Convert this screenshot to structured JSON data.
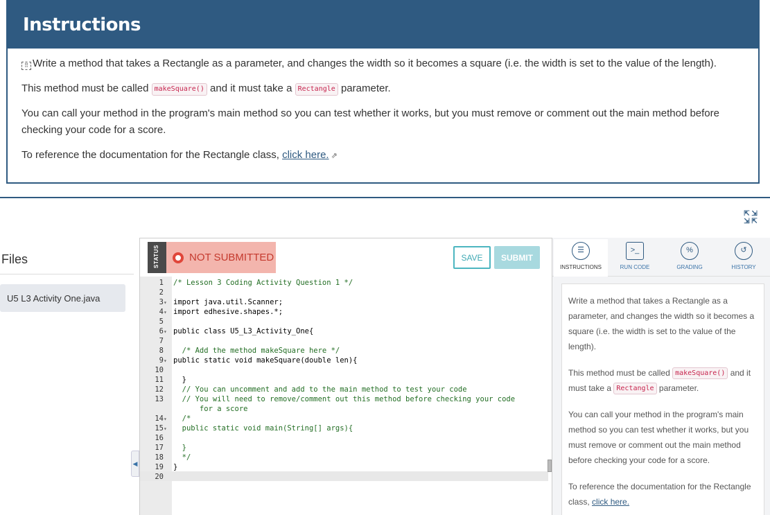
{
  "instructions": {
    "title": "Instructions",
    "p1": "Write a method that takes a Rectangle as a parameter, and changes the width so it becomes a square (i.e. the width is set to the value of the length).",
    "p2_before": "This method must be called",
    "p2_code1": "makeSquare()",
    "p2_mid": "and it must take a",
    "p2_code2": "Rectangle",
    "p2_after": "parameter.",
    "p3": "You can call your method in the program's main method so you can test whether it works, but you must remove or comment out the main method before checking your code for a score.",
    "p4_before": "To reference the documentation for the Rectangle class,",
    "p4_link": "click here."
  },
  "files": {
    "title": "Files",
    "items": [
      "U5 L3 Activity One.java"
    ]
  },
  "editor": {
    "status_label": "STATUS",
    "status_text": "NOT SUBMITTED",
    "save_label": "SAVE",
    "submit_label": "SUBMIT",
    "lines": [
      {
        "n": "1",
        "fold": "",
        "text": "/* Lesson 3 Coding Activity Question 1 */",
        "cls": "c-comment"
      },
      {
        "n": "2",
        "fold": "",
        "text": "",
        "cls": "txt"
      },
      {
        "n": "3",
        "fold": "▾",
        "text": "import java.util.Scanner;",
        "cls": "txt"
      },
      {
        "n": "4",
        "fold": "▾",
        "text": "import edhesive.shapes.*;",
        "cls": "txt"
      },
      {
        "n": "5",
        "fold": "",
        "text": "",
        "cls": "txt"
      },
      {
        "n": "6",
        "fold": "▾",
        "text": "public class U5_L3_Activity_One{",
        "cls": "txt"
      },
      {
        "n": "7",
        "fold": "",
        "text": "",
        "cls": "txt"
      },
      {
        "n": "8",
        "fold": "",
        "text": "  /* Add the method makeSquare here */",
        "cls": "c-comment"
      },
      {
        "n": "9",
        "fold": "▾",
        "text": "public static void makeSquare(double len){",
        "cls": "txt"
      },
      {
        "n": "10",
        "fold": "",
        "text": "",
        "cls": "txt"
      },
      {
        "n": "11",
        "fold": "",
        "text": "  }",
        "cls": "txt"
      },
      {
        "n": "12",
        "fold": "",
        "text": "  // You can uncomment and add to the main method to test your code",
        "cls": "c-comment"
      },
      {
        "n": "13",
        "fold": "",
        "text": "  // You will need to remove/comment out this method before checking your code",
        "cls": "c-comment"
      },
      {
        "n": "",
        "fold": "",
        "text": "      for a score",
        "cls": "c-comment"
      },
      {
        "n": "14",
        "fold": "▾",
        "text": "  /*",
        "cls": "c-comment"
      },
      {
        "n": "15",
        "fold": "▾",
        "text": "  public static void main(String[] args){",
        "cls": "c-comment"
      },
      {
        "n": "16",
        "fold": "",
        "text": "",
        "cls": "c-comment"
      },
      {
        "n": "17",
        "fold": "",
        "text": "  }",
        "cls": "c-comment"
      },
      {
        "n": "18",
        "fold": "",
        "text": "  */",
        "cls": "c-comment"
      },
      {
        "n": "19",
        "fold": "",
        "text": "}",
        "cls": "txt"
      },
      {
        "n": "20",
        "fold": "",
        "text": "",
        "cls": "txt"
      }
    ]
  },
  "right_panel": {
    "tabs": [
      {
        "label": "INSTRUCTIONS",
        "icon": "checklist-icon"
      },
      {
        "label": "RUN CODE",
        "icon": "terminal-icon"
      },
      {
        "label": "GRADING",
        "icon": "percent-badge-icon"
      },
      {
        "label": "HISTORY",
        "icon": "history-icon"
      }
    ],
    "p1": "Write a method that takes a Rectangle as a parameter, and changes the width so it becomes a square (i.e. the width is set to the value of the length).",
    "p2_before": "This method must be called",
    "p2_code1": "makeSquare()",
    "p2_mid": "and it must take a",
    "p2_code2": "Rectangle",
    "p2_after": "parameter.",
    "p3": "You can call your method in the program's main method so you can test whether it works, but you must remove or comment out the main method before checking your code for a score.",
    "p4_before": "To reference the documentation for the Rectangle class,",
    "p4_link": "click here."
  },
  "colors": {
    "header_blue": "#2f5a81",
    "status_red": "#e0463a",
    "status_bg": "#f3b5ad",
    "save_teal": "#4cb6c0"
  }
}
